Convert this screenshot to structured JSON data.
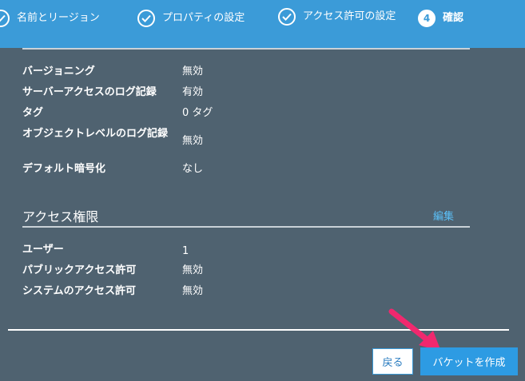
{
  "steps": [
    {
      "label": "名前とリージョン",
      "state": "done"
    },
    {
      "label": "プロパティの設定",
      "state": "done"
    },
    {
      "label": "アクセス許可の設定",
      "state": "done"
    },
    {
      "label": "確認",
      "number": "4",
      "state": "current"
    }
  ],
  "properties": [
    {
      "key": "バージョニング",
      "value": "無効"
    },
    {
      "key": "サーバーアクセスのログ記録",
      "value": "有効"
    },
    {
      "key": "タグ",
      "value": "0 タグ"
    },
    {
      "key": "オブジェクトレベルのログ記録",
      "value": "無効"
    },
    {
      "key": "デフォルト暗号化",
      "value": "なし"
    }
  ],
  "access": {
    "title": "アクセス権限",
    "edit_label": "編集",
    "rows": [
      {
        "key": "ユーザー",
        "value": "1"
      },
      {
        "key": "パブリックアクセス許可",
        "value": "無効"
      },
      {
        "key": "システムのアクセス許可",
        "value": "無効"
      }
    ]
  },
  "footer": {
    "back_label": "戻る",
    "create_label": "バケットを作成"
  },
  "colors": {
    "stepbar": "#3b9bd8",
    "panel": "#4f6270",
    "link": "#5bc0f8",
    "primary_button": "#2d9be3",
    "annotation_arrow": "#f0286e"
  }
}
